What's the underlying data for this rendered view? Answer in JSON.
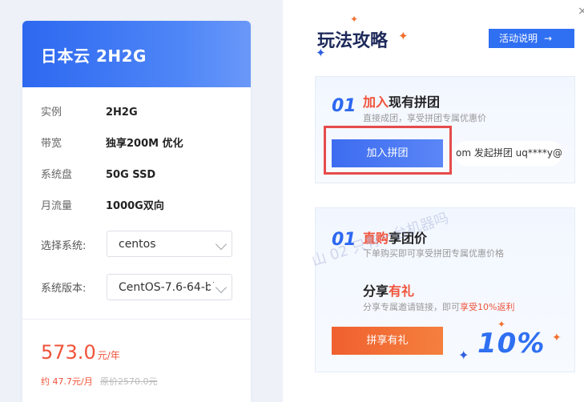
{
  "product": {
    "title": "日本云 2H2G",
    "specs": [
      {
        "label": "实例",
        "value": "2H2G"
      },
      {
        "label": "带宽",
        "value": "独享200M 优化"
      },
      {
        "label": "系统盘",
        "value": "50G SSD"
      },
      {
        "label": "月流量",
        "value": "1000G双向"
      }
    ],
    "system_label": "选择系统:",
    "system_value": "centos",
    "version_label": "系统版本:",
    "version_value": "CentOS-7.6-64-bi",
    "price": "573.0",
    "price_unit": "元/年",
    "monthly_price": "约 47.7元/月",
    "original_price": "原价2570.0元"
  },
  "guide": {
    "title": "玩法攻略",
    "activity_button": "活动说明",
    "activity_arrow": "→",
    "close": "×",
    "step1": {
      "num": "01",
      "title_highlight": "加入",
      "title_rest": "现有拼团",
      "desc": "直接成团，享受拼团专属优惠价",
      "join_button": "加入拼团",
      "invite_text": "om 发起拼团   uq****y@"
    },
    "step2": {
      "num": "01",
      "title_highlight": "直购",
      "title_rest": "享团价",
      "desc": "下单购买即可享受拼团专属优惠价格",
      "watermark": "山 02 只有一台机器吗"
    },
    "step3": {
      "num": "02",
      "title_prefix": "分享",
      "title_highlight": "有礼",
      "desc_prefix": "分享专属邀请链接，即可",
      "desc_highlight": "享受10%返利",
      "share_button": "拼享有礼",
      "percent": "10%"
    }
  },
  "colors": {
    "accent_blue": "#2d68f0",
    "accent_red": "#f0533a",
    "highlight_border": "#e64b4b"
  },
  "icons": {
    "close": "close-icon",
    "chevron": "chevron-down-icon",
    "star": "sparkle-star-icon"
  }
}
